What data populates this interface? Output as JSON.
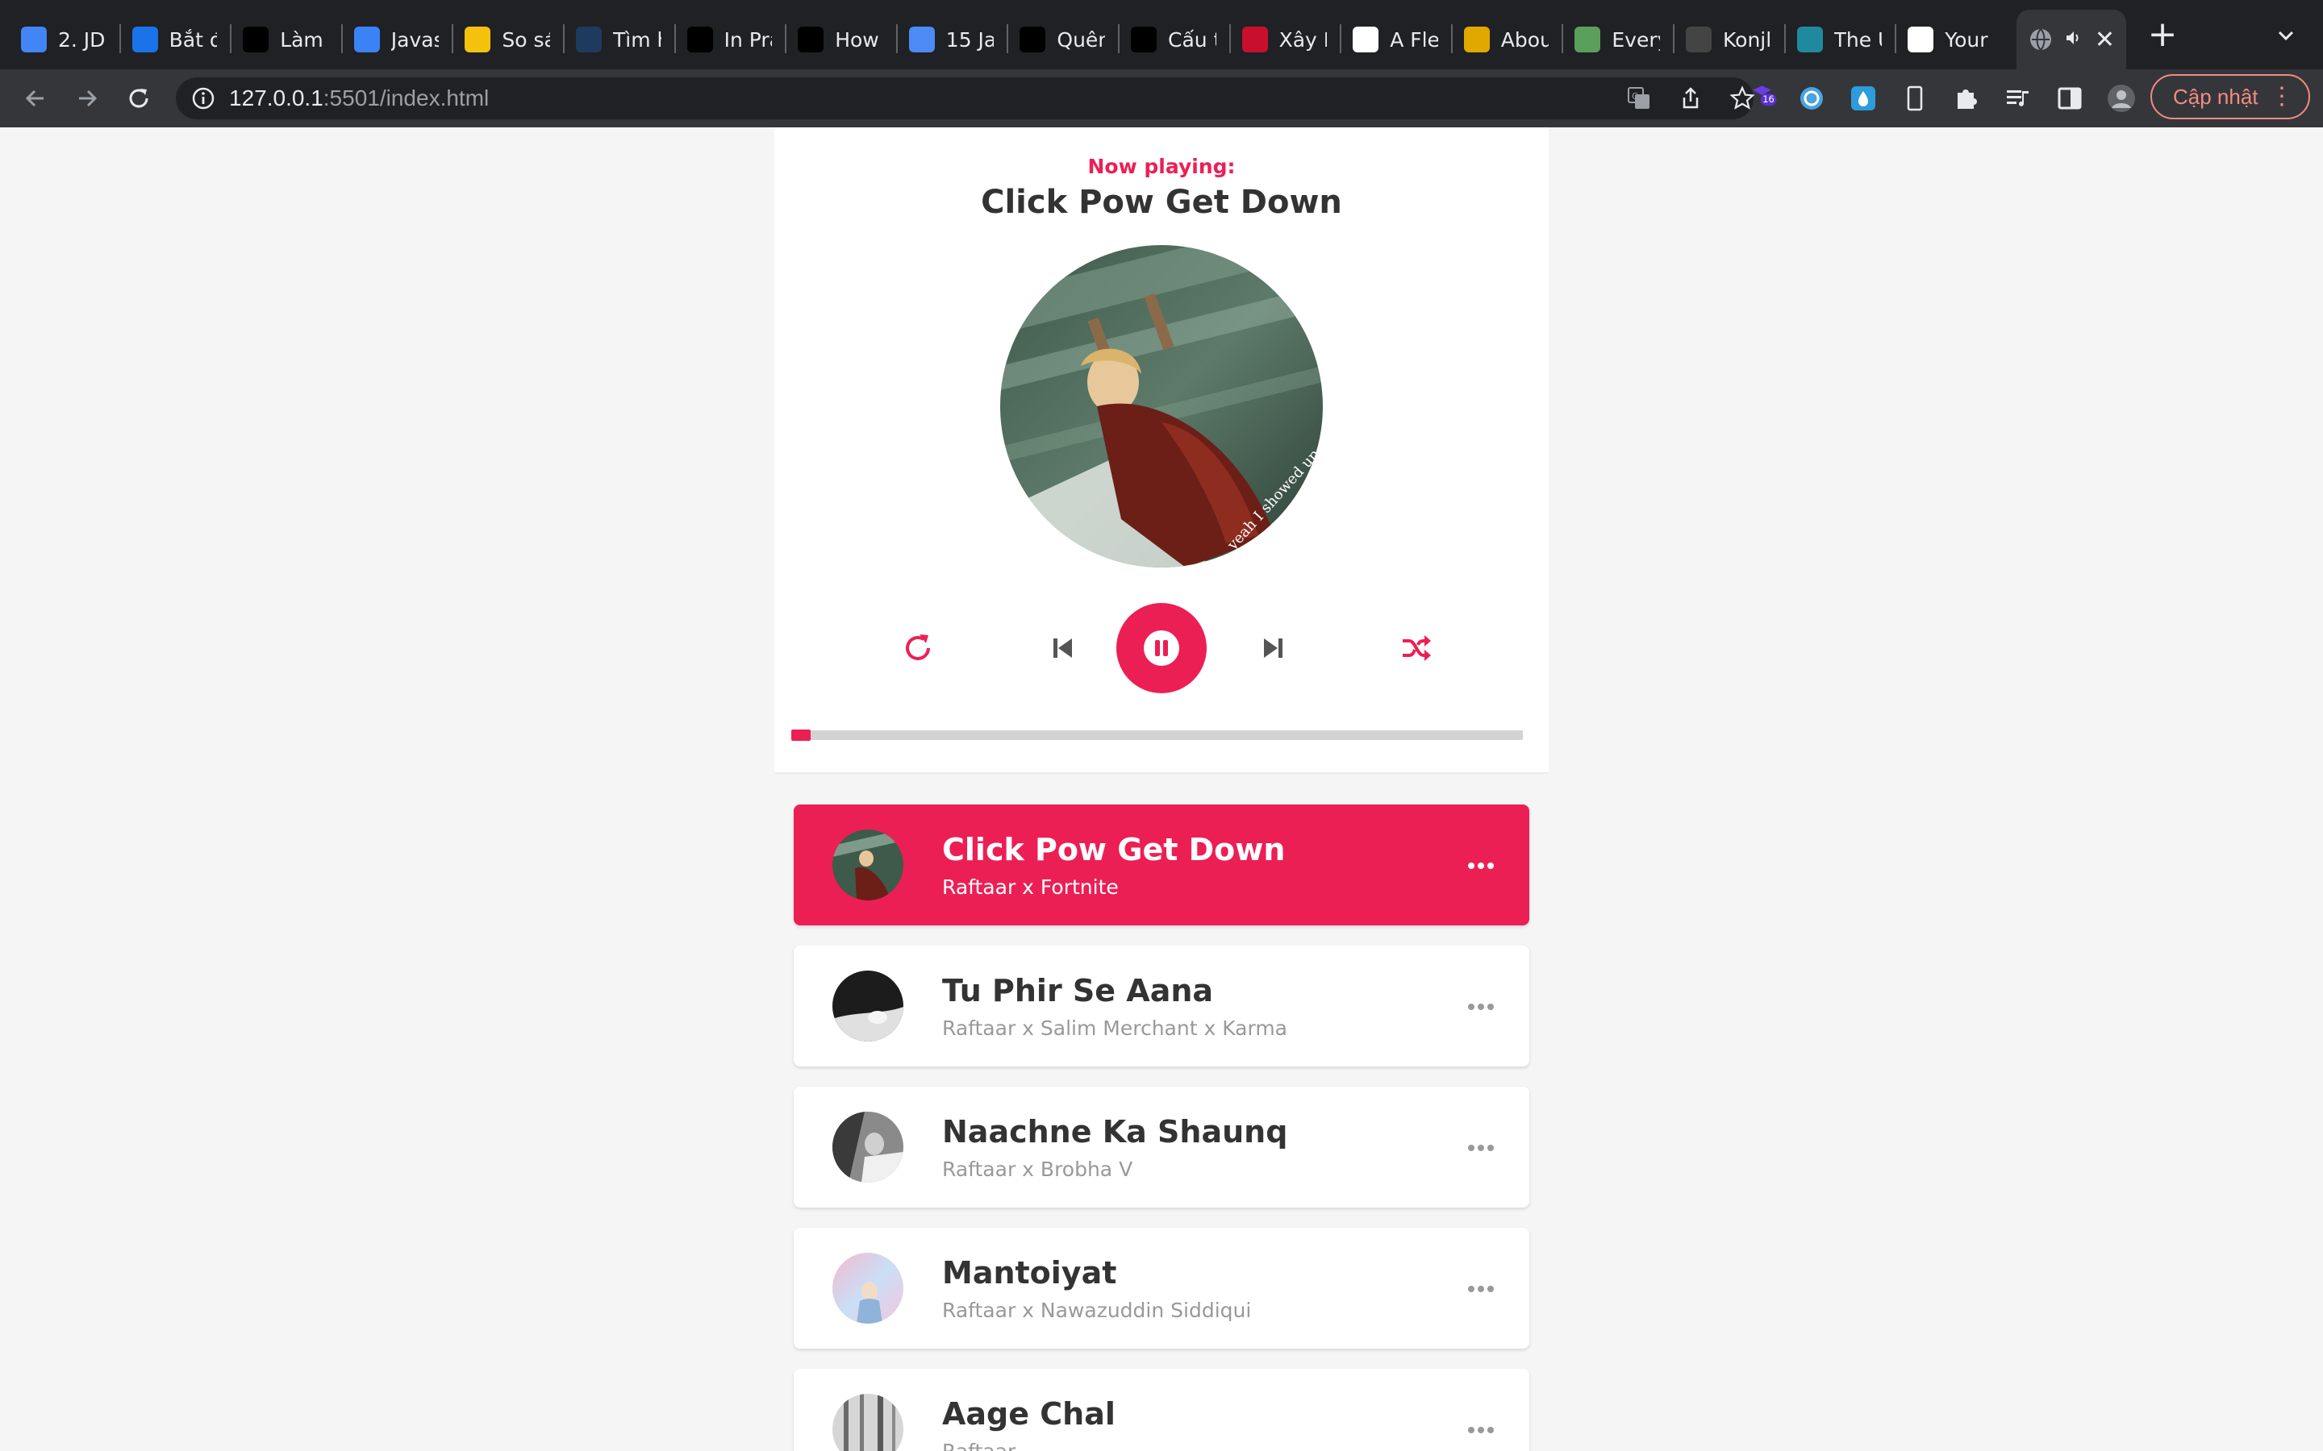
{
  "browser": {
    "tabs": [
      {
        "title": "2. JD",
        "icon": "docs-icon",
        "color": "#4285f4"
      },
      {
        "title": "Bắt đ",
        "icon": "bookmark-icon",
        "color": "#1a73e8"
      },
      {
        "title": "Làm t",
        "icon": "circle-logo-icon",
        "color": "#000000"
      },
      {
        "title": "Javas",
        "icon": "infinity-icon",
        "color": "#3b82f6"
      },
      {
        "title": "So sá",
        "icon": "note-icon",
        "color": "#f4c20d"
      },
      {
        "title": "Tìm h",
        "icon": "k-icon",
        "color": "#1e3a5f"
      },
      {
        "title": "In Pra",
        "icon": "slash-circle-icon",
        "color": "#000000"
      },
      {
        "title": "How",
        "icon": "dev-icon",
        "color": "#000000"
      },
      {
        "title": "15 Ja",
        "icon": "v-icon",
        "color": "#4c8bf5"
      },
      {
        "title": "Quên",
        "icon": "a-icon",
        "color": "#000000"
      },
      {
        "title": "Cấu t",
        "icon": "a-icon",
        "color": "#000000"
      },
      {
        "title": "Xây D",
        "icon": "red-logo-icon",
        "color": "#c8102e"
      },
      {
        "title": "A Fle",
        "icon": "codepen-icon",
        "color": "#ffffff"
      },
      {
        "title": "Abou",
        "icon": "sunflower-icon",
        "color": "#e0a800"
      },
      {
        "title": "Every",
        "icon": "photo-icon",
        "color": "#5aa05a"
      },
      {
        "title": "Konjl",
        "icon": "konjl-icon",
        "color": "#444444"
      },
      {
        "title": "The U",
        "icon": "the-u-icon",
        "color": "#1f8a9e"
      },
      {
        "title": "Your",
        "icon": "github-icon",
        "color": "#ffffff"
      }
    ],
    "active_tab": {
      "title": "",
      "icon": "globe-icon",
      "audio_icon": "speaker-icon"
    },
    "new_tab_label": "+",
    "url_host": "127.0.0.1",
    "url_rest": ":5501/index.html",
    "extension_badge": "16",
    "update_label": "Cập nhật"
  },
  "player": {
    "now_playing_label": "Now playing:",
    "current_title": "Click Pow Get Down",
    "progress": 0.04,
    "accent": "#ec1f55",
    "cd_text": "yeah I showed up at"
  },
  "playlist": [
    {
      "title": "Click Pow Get Down",
      "author": "Raftaar x Fortnite",
      "active": true
    },
    {
      "title": "Tu Phir Se Aana",
      "author": "Raftaar x Salim Merchant x Karma",
      "active": false
    },
    {
      "title": "Naachne Ka Shaunq",
      "author": "Raftaar x Brobha V",
      "active": false
    },
    {
      "title": "Mantoiyat",
      "author": "Raftaar x Nawazuddin Siddiqui",
      "active": false
    },
    {
      "title": "Aage Chal",
      "author": "Raftaar",
      "active": false
    }
  ]
}
